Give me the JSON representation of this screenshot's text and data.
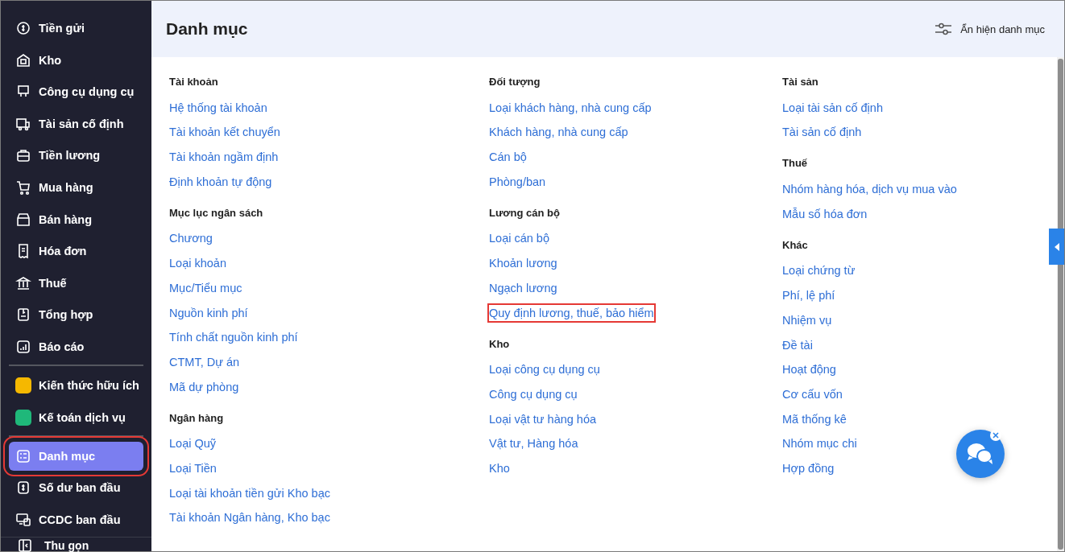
{
  "sidebar": {
    "groups": [
      [
        {
          "label": "Tiền gửi",
          "kind": "icon",
          "selected": false,
          "highlighted": false
        },
        {
          "label": "Kho",
          "kind": "icon",
          "selected": false,
          "highlighted": false
        },
        {
          "label": "Công cụ dụng cụ",
          "kind": "icon",
          "selected": false,
          "highlighted": false
        },
        {
          "label": "Tài sản cố định",
          "kind": "icon",
          "selected": false,
          "highlighted": false
        },
        {
          "label": "Tiền lương",
          "kind": "icon",
          "selected": false,
          "highlighted": false
        },
        {
          "label": "Mua hàng",
          "kind": "icon",
          "selected": false,
          "highlighted": false
        },
        {
          "label": "Bán hàng",
          "kind": "icon",
          "selected": false,
          "highlighted": false
        },
        {
          "label": "Hóa đơn",
          "kind": "icon",
          "selected": false,
          "highlighted": false
        },
        {
          "label": "Thuế",
          "kind": "icon",
          "selected": false,
          "highlighted": false
        },
        {
          "label": "Tổng hợp",
          "kind": "icon",
          "selected": false,
          "highlighted": false
        },
        {
          "label": "Báo cáo",
          "kind": "icon",
          "selected": false,
          "highlighted": false
        }
      ],
      [
        {
          "label": "Kiến thức hữu ích",
          "kind": "app",
          "color": "#f5b800",
          "selected": false,
          "highlighted": false
        },
        {
          "label": "Kế toán dịch vụ",
          "kind": "app",
          "color": "#1fb87a",
          "selected": false,
          "highlighted": false
        }
      ],
      [
        {
          "label": "Danh mục",
          "kind": "icon",
          "selected": true,
          "highlighted": true
        },
        {
          "label": "Số dư ban đầu",
          "kind": "icon",
          "selected": false,
          "highlighted": false
        },
        {
          "label": "CCDC ban đầu",
          "kind": "icon",
          "selected": false,
          "highlighted": false
        }
      ]
    ],
    "collapse": "Thu gọn"
  },
  "header": {
    "title": "Danh mục",
    "action": "Ẩn hiện danh mục"
  },
  "columns": [
    [
      {
        "title": "Tài khoản",
        "links": [
          {
            "label": "Hệ thống tài khoản",
            "highlighted": false
          },
          {
            "label": "Tài khoản kết chuyển",
            "highlighted": false
          },
          {
            "label": "Tài khoản ngầm định",
            "highlighted": false
          },
          {
            "label": "Định khoản tự động",
            "highlighted": false
          }
        ]
      },
      {
        "title": "Mục lục ngân sách",
        "links": [
          {
            "label": "Chương",
            "highlighted": false
          },
          {
            "label": "Loại khoản",
            "highlighted": false
          },
          {
            "label": "Mục/Tiểu mục",
            "highlighted": false
          },
          {
            "label": "Nguồn kinh phí",
            "highlighted": false
          },
          {
            "label": "Tính chất nguồn kinh phí",
            "highlighted": false
          },
          {
            "label": "CTMT, Dự án",
            "highlighted": false
          },
          {
            "label": "Mã dự phòng",
            "highlighted": false
          }
        ]
      },
      {
        "title": "Ngân hàng",
        "links": [
          {
            "label": "Loại Quỹ",
            "highlighted": false
          },
          {
            "label": "Loại Tiền",
            "highlighted": false
          },
          {
            "label": "Loại tài khoản tiền gửi Kho bạc",
            "highlighted": false
          },
          {
            "label": "Tài khoản Ngân hàng, Kho bạc",
            "highlighted": false
          }
        ]
      }
    ],
    [
      {
        "title": "Đối tượng",
        "links": [
          {
            "label": "Loại khách hàng, nhà cung cấp",
            "highlighted": false
          },
          {
            "label": "Khách hàng, nhà cung cấp",
            "highlighted": false
          },
          {
            "label": "Cán bộ",
            "highlighted": false
          },
          {
            "label": "Phòng/ban",
            "highlighted": false
          }
        ]
      },
      {
        "title": "Lương cán bộ",
        "links": [
          {
            "label": "Loại cán bộ",
            "highlighted": false
          },
          {
            "label": "Khoản lương",
            "highlighted": false
          },
          {
            "label": "Ngạch lương",
            "highlighted": false
          },
          {
            "label": "Quy định lương, thuế, bảo hiểm",
            "highlighted": true
          }
        ]
      },
      {
        "title": "Kho",
        "links": [
          {
            "label": "Loại công cụ dụng cụ",
            "highlighted": false
          },
          {
            "label": "Công cụ dụng cụ",
            "highlighted": false
          },
          {
            "label": "Loại vật tư hàng hóa",
            "highlighted": false
          },
          {
            "label": "Vật tư, Hàng hóa",
            "highlighted": false
          },
          {
            "label": "Kho",
            "highlighted": false
          }
        ]
      }
    ],
    [
      {
        "title": "Tài sản",
        "links": [
          {
            "label": "Loại tài sản cố định",
            "highlighted": false
          },
          {
            "label": "Tài sản cố định",
            "highlighted": false
          }
        ]
      },
      {
        "title": "Thuế",
        "links": [
          {
            "label": "Nhóm hàng hóa, dịch vụ mua vào",
            "highlighted": false
          },
          {
            "label": "Mẫu số hóa đơn",
            "highlighted": false
          }
        ]
      },
      {
        "title": "Khác",
        "links": [
          {
            "label": "Loại chứng từ",
            "highlighted": false
          },
          {
            "label": "Phí, lệ phí",
            "highlighted": false
          },
          {
            "label": "Nhiệm vụ",
            "highlighted": false
          },
          {
            "label": "Đề tài",
            "highlighted": false
          },
          {
            "label": "Hoạt động",
            "highlighted": false
          },
          {
            "label": "Cơ cấu vốn",
            "highlighted": false
          },
          {
            "label": "Mã thống kê",
            "highlighted": false
          },
          {
            "label": "Nhóm mục chi",
            "highlighted": false
          },
          {
            "label": "Hợp đồng",
            "highlighted": false
          }
        ]
      }
    ]
  ]
}
